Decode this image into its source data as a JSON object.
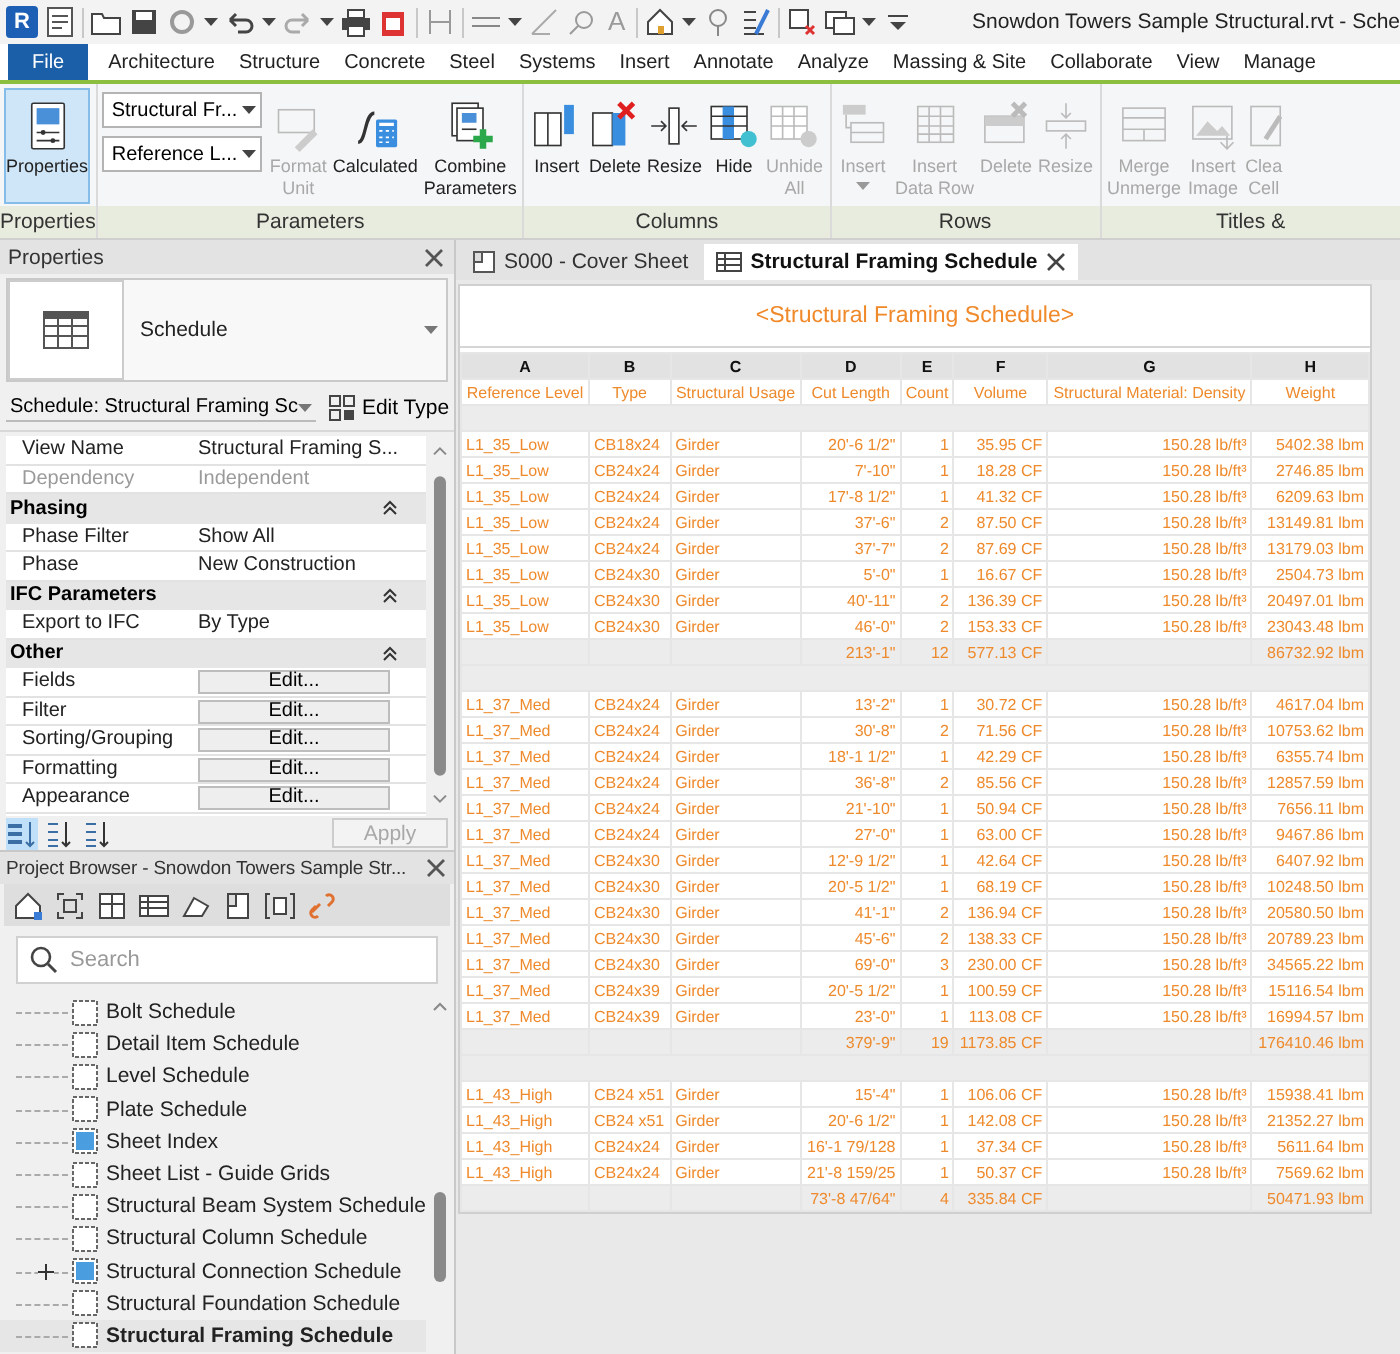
{
  "app_logo": "R",
  "text_tool": "A",
  "window": {
    "title": "Snowdon Towers Sample Structural.rvt - Sche"
  },
  "ribbon_tabs": [
    {
      "label": "File",
      "selected": true
    },
    {
      "label": "Architecture",
      "selected": false
    },
    {
      "label": "Structure",
      "selected": false
    },
    {
      "label": "Concrete",
      "selected": false
    },
    {
      "label": "Steel",
      "selected": false
    },
    {
      "label": "Systems",
      "selected": false
    },
    {
      "label": "Insert",
      "selected": false
    },
    {
      "label": "Annotate",
      "selected": false
    },
    {
      "label": "Analyze",
      "selected": false
    },
    {
      "label": "Massing & Site",
      "selected": false
    },
    {
      "label": "Collaborate",
      "selected": false
    },
    {
      "label": "View",
      "selected": false
    },
    {
      "label": "Manage",
      "selected": false
    }
  ],
  "ribbon_panels": [
    {
      "title": "Properties",
      "tools": [
        {
          "kind": "large",
          "label": "Properties",
          "selected": true,
          "disabled": false
        }
      ]
    },
    {
      "title": "Parameters",
      "tools": [
        {
          "kind": "combo",
          "values": [
            "Structural Fr...",
            "Reference L..."
          ]
        },
        {
          "kind": "large",
          "label": "Format\nUnit",
          "selected": false,
          "disabled": true
        },
        {
          "kind": "large",
          "label": "Calculated",
          "selected": false,
          "disabled": false
        },
        {
          "kind": "large",
          "label": "Combine\nParameters",
          "selected": false,
          "disabled": false
        }
      ]
    },
    {
      "title": "Columns",
      "tools": [
        {
          "kind": "large",
          "label": "Insert",
          "selected": false,
          "disabled": false
        },
        {
          "kind": "large",
          "label": "Delete",
          "selected": false,
          "disabled": false
        },
        {
          "kind": "large",
          "label": "Resize",
          "selected": false,
          "disabled": false
        },
        {
          "kind": "large",
          "label": "Hide",
          "selected": false,
          "disabled": false
        },
        {
          "kind": "large",
          "label": "Unhide\nAll",
          "selected": false,
          "disabled": true
        }
      ]
    },
    {
      "title": "Rows",
      "tools": [
        {
          "kind": "split",
          "label": "Insert",
          "selected": false,
          "disabled": true
        },
        {
          "kind": "large",
          "label": "Insert\nData Row",
          "selected": false,
          "disabled": true
        },
        {
          "kind": "large",
          "label": "Delete",
          "selected": false,
          "disabled": true
        },
        {
          "kind": "large",
          "label": "Resize",
          "selected": false,
          "disabled": true
        }
      ]
    },
    {
      "title": "Titles &",
      "tools": [
        {
          "kind": "large",
          "label": "Merge\nUnmerge",
          "selected": false,
          "disabled": true
        },
        {
          "kind": "large",
          "label": "Insert\nImage",
          "selected": false,
          "disabled": true
        },
        {
          "kind": "large",
          "label": "Clea\nCell",
          "selected": false,
          "disabled": true
        }
      ]
    }
  ],
  "properties": {
    "title": "Properties",
    "type_name": "Schedule",
    "instance_selector": "Schedule: Structural Framing Sc",
    "edit_type": "Edit Type",
    "rows": [
      {
        "kind": "param",
        "name": "View Name",
        "value": "Structural Framing S...",
        "disabled": false
      },
      {
        "kind": "param",
        "name": "Dependency",
        "value": "Independent",
        "disabled": true
      },
      {
        "kind": "section",
        "name": "Phasing"
      },
      {
        "kind": "param",
        "name": "Phase Filter",
        "value": "Show All",
        "disabled": false
      },
      {
        "kind": "param",
        "name": "Phase",
        "value": "New Construction",
        "disabled": false
      },
      {
        "kind": "section",
        "name": "IFC Parameters"
      },
      {
        "kind": "param",
        "name": "Export to IFC",
        "value": "By Type",
        "disabled": false
      },
      {
        "kind": "section",
        "name": "Other"
      },
      {
        "kind": "button",
        "name": "Fields",
        "value": "Edit..."
      },
      {
        "kind": "button",
        "name": "Filter",
        "value": "Edit..."
      },
      {
        "kind": "button",
        "name": "Sorting/Grouping",
        "value": "Edit..."
      },
      {
        "kind": "button",
        "name": "Formatting",
        "value": "Edit..."
      },
      {
        "kind": "button",
        "name": "Appearance",
        "value": "Edit..."
      }
    ],
    "sort_buttons": [
      {
        "selected": true
      },
      {
        "selected": false
      },
      {
        "selected": false
      }
    ],
    "apply": {
      "label": "Apply",
      "disabled": true
    }
  },
  "project_browser": {
    "title": "Project Browser - Snowdon Towers Sample Str...",
    "search": {
      "placeholder": "Search"
    },
    "items": [
      {
        "label": "Bolt Schedule",
        "kind": "plain",
        "collapsed": false,
        "selected": false
      },
      {
        "label": "Detail Item Schedule",
        "kind": "plain",
        "collapsed": false,
        "selected": false
      },
      {
        "label": "Level Schedule",
        "kind": "plain",
        "collapsed": false,
        "selected": false
      },
      {
        "label": "Plate Schedule",
        "kind": "plain",
        "collapsed": false,
        "selected": false
      },
      {
        "label": "Sheet Index",
        "kind": "highlighted",
        "collapsed": false,
        "selected": false
      },
      {
        "label": "Sheet List - Guide Grids",
        "kind": "plain",
        "collapsed": false,
        "selected": false
      },
      {
        "label": "Structural Beam System Schedule",
        "kind": "plain",
        "collapsed": false,
        "selected": false
      },
      {
        "label": "Structural Column Schedule",
        "kind": "plain",
        "collapsed": false,
        "selected": false
      },
      {
        "label": "Structural Connection Schedule",
        "kind": "highlighted",
        "collapsed": true,
        "selected": false
      },
      {
        "label": "Structural Foundation Schedule",
        "kind": "plain",
        "collapsed": false,
        "selected": false
      },
      {
        "label": "Structural Framing Schedule",
        "kind": "plain",
        "collapsed": false,
        "selected": true
      }
    ]
  },
  "view_tabs": [
    {
      "label": "S000 - Cover Sheet",
      "kind": "sheet",
      "selected": false
    },
    {
      "label": "Structural Framing Schedule",
      "kind": "schedule",
      "selected": true
    }
  ],
  "schedule": {
    "title": "<Structural Framing Schedule>",
    "columns": [
      {
        "letter": "A",
        "heading": "Reference Level"
      },
      {
        "letter": "B",
        "heading": "Type"
      },
      {
        "letter": "C",
        "heading": "Structural Usage"
      },
      {
        "letter": "D",
        "heading": "Cut Length"
      },
      {
        "letter": "E",
        "heading": "Count"
      },
      {
        "letter": "F",
        "heading": "Volume"
      },
      {
        "letter": "G",
        "heading": "Structural Material: Density"
      },
      {
        "letter": "H",
        "heading": "Weight"
      }
    ],
    "groups": [
      {
        "rows": [
          [
            "L1_35_Low",
            "CB18x24",
            "Girder",
            "20'-6 1/2\"",
            "1",
            "35.95 CF",
            "150.28 lb/ft³",
            "5402.38 lbm"
          ],
          [
            "L1_35_Low",
            "CB24x24",
            "Girder",
            "7'-10\"",
            "1",
            "18.28 CF",
            "150.28 lb/ft³",
            "2746.85 lbm"
          ],
          [
            "L1_35_Low",
            "CB24x24",
            "Girder",
            "17'-8 1/2\"",
            "1",
            "41.32 CF",
            "150.28 lb/ft³",
            "6209.63 lbm"
          ],
          [
            "L1_35_Low",
            "CB24x24",
            "Girder",
            "37'-6\"",
            "2",
            "87.50 CF",
            "150.28 lb/ft³",
            "13149.81 lbm"
          ],
          [
            "L1_35_Low",
            "CB24x24",
            "Girder",
            "37'-7\"",
            "2",
            "87.69 CF",
            "150.28 lb/ft³",
            "13179.03 lbm"
          ],
          [
            "L1_35_Low",
            "CB24x30",
            "Girder",
            "5'-0\"",
            "1",
            "16.67 CF",
            "150.28 lb/ft³",
            "2504.73 lbm"
          ],
          [
            "L1_35_Low",
            "CB24x30",
            "Girder",
            "40'-11\"",
            "2",
            "136.39 CF",
            "150.28 lb/ft³",
            "20497.01 lbm"
          ],
          [
            "L1_35_Low",
            "CB24x30",
            "Girder",
            "46'-0\"",
            "2",
            "153.33 CF",
            "150.28 lb/ft³",
            "23043.48 lbm"
          ]
        ],
        "totals": {
          "cut_length": "213'-1\"",
          "count": "12",
          "volume": "577.13 CF",
          "weight": "86732.92 lbm"
        }
      },
      {
        "rows": [
          [
            "L1_37_Med",
            "CB24x24",
            "Girder",
            "13'-2\"",
            "1",
            "30.72 CF",
            "150.28 lb/ft³",
            "4617.04 lbm"
          ],
          [
            "L1_37_Med",
            "CB24x24",
            "Girder",
            "30'-8\"",
            "2",
            "71.56 CF",
            "150.28 lb/ft³",
            "10753.62 lbm"
          ],
          [
            "L1_37_Med",
            "CB24x24",
            "Girder",
            "18'-1 1/2\"",
            "1",
            "42.29 CF",
            "150.28 lb/ft³",
            "6355.74 lbm"
          ],
          [
            "L1_37_Med",
            "CB24x24",
            "Girder",
            "36'-8\"",
            "2",
            "85.56 CF",
            "150.28 lb/ft³",
            "12857.59 lbm"
          ],
          [
            "L1_37_Med",
            "CB24x24",
            "Girder",
            "21'-10\"",
            "1",
            "50.94 CF",
            "150.28 lb/ft³",
            "7656.11 lbm"
          ],
          [
            "L1_37_Med",
            "CB24x24",
            "Girder",
            "27'-0\"",
            "1",
            "63.00 CF",
            "150.28 lb/ft³",
            "9467.86 lbm"
          ],
          [
            "L1_37_Med",
            "CB24x30",
            "Girder",
            "12'-9 1/2\"",
            "1",
            "42.64 CF",
            "150.28 lb/ft³",
            "6407.92 lbm"
          ],
          [
            "L1_37_Med",
            "CB24x30",
            "Girder",
            "20'-5 1/2\"",
            "1",
            "68.19 CF",
            "150.28 lb/ft³",
            "10248.50 lbm"
          ],
          [
            "L1_37_Med",
            "CB24x30",
            "Girder",
            "41'-1\"",
            "2",
            "136.94 CF",
            "150.28 lb/ft³",
            "20580.50 lbm"
          ],
          [
            "L1_37_Med",
            "CB24x30",
            "Girder",
            "45'-6\"",
            "2",
            "138.33 CF",
            "150.28 lb/ft³",
            "20789.23 lbm"
          ],
          [
            "L1_37_Med",
            "CB24x30",
            "Girder",
            "69'-0\"",
            "3",
            "230.00 CF",
            "150.28 lb/ft³",
            "34565.22 lbm"
          ],
          [
            "L1_37_Med",
            "CB24x39",
            "Girder",
            "20'-5 1/2\"",
            "1",
            "100.59 CF",
            "150.28 lb/ft³",
            "15116.54 lbm"
          ],
          [
            "L1_37_Med",
            "CB24x39",
            "Girder",
            "23'-0\"",
            "1",
            "113.08 CF",
            "150.28 lb/ft³",
            "16994.57 lbm"
          ]
        ],
        "totals": {
          "cut_length": "379'-9\"",
          "count": "19",
          "volume": "1173.85 CF",
          "weight": "176410.46 lbm"
        }
      },
      {
        "rows": [
          [
            "L1_43_High",
            "CB24 x51",
            "Girder",
            "15'-4\"",
            "1",
            "106.06 CF",
            "150.28 lb/ft³",
            "15938.41 lbm"
          ],
          [
            "L1_43_High",
            "CB24 x51",
            "Girder",
            "20'-6 1/2\"",
            "1",
            "142.08 CF",
            "150.28 lb/ft³",
            "21352.27 lbm"
          ],
          [
            "L1_43_High",
            "CB24x24",
            "Girder",
            "16'-1 79/128",
            "1",
            "37.34 CF",
            "150.28 lb/ft³",
            "5611.64 lbm"
          ],
          [
            "L1_43_High",
            "CB24x24",
            "Girder",
            "21'-8 159/25",
            "1",
            "50.37 CF",
            "150.28 lb/ft³",
            "7569.62 lbm"
          ]
        ],
        "totals": {
          "cut_length": "73'-8 47/64\"",
          "count": "4",
          "volume": "335.84 CF",
          "weight": "50471.93 lbm"
        }
      }
    ]
  }
}
